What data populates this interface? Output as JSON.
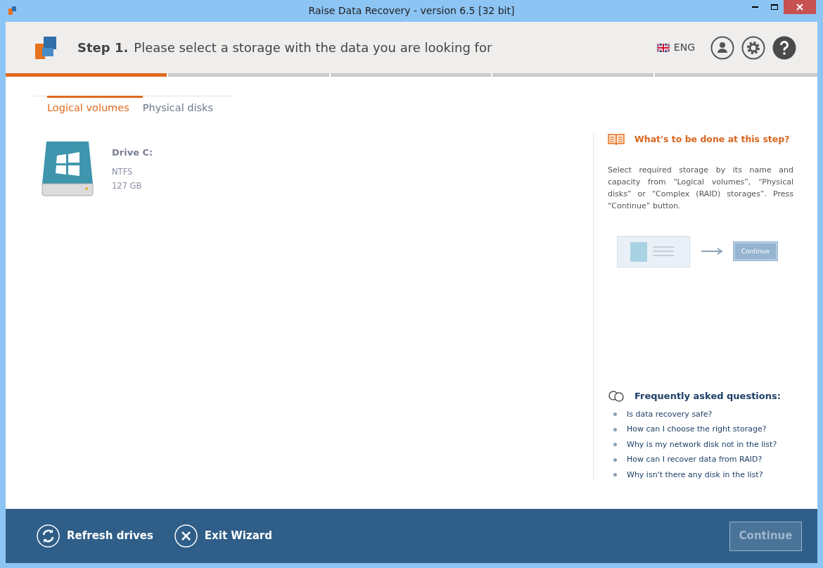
{
  "window": {
    "title": "Raise Data Recovery - version 6.5 [32 bit]"
  },
  "header": {
    "step": "Step 1.",
    "instruction": "Please select a storage with the data you are looking for",
    "language": "ENG"
  },
  "progress": [
    {
      "done": true
    },
    {
      "done": false
    },
    {
      "done": false
    },
    {
      "done": false
    },
    {
      "done": false
    }
  ],
  "tabs": [
    {
      "label": "Logical volumes",
      "selected": true
    },
    {
      "label": "Physical disks",
      "selected": false
    }
  ],
  "drives": [
    {
      "name": "Drive C:",
      "filesystem": "NTFS",
      "size": "127 GB"
    }
  ],
  "help": {
    "title": "What's to be done at this step?",
    "text": "Select required storage by its name and capacity from “Logical volumes”, “Physical disks” or “Complex (RAID) storages”. Press “Continue” button.",
    "illustration_button": "Continue"
  },
  "faq": {
    "title": "Frequently asked questions:",
    "items": [
      "Is data recovery safe?",
      "How can I choose the right storage?",
      "Why is my network disk not in the list?",
      "How can I recover data from RAID?",
      "Why isn't there any disk in the list?"
    ]
  },
  "footer": {
    "refresh": "Refresh drives",
    "exit": "Exit Wizard",
    "continue": {
      "label": "Continue",
      "disabled": true
    }
  }
}
